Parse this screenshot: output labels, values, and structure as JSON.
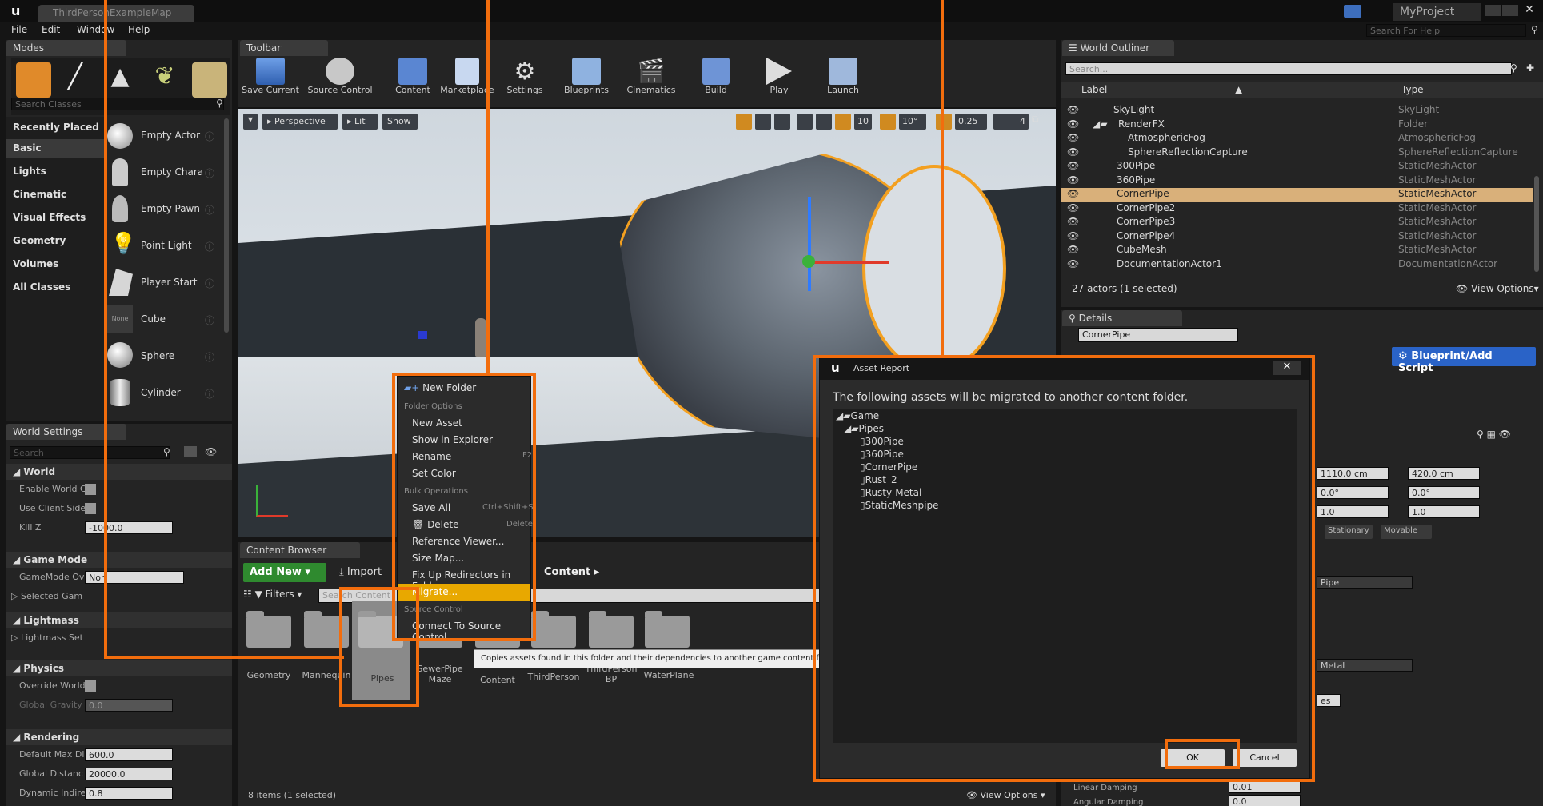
{
  "window": {
    "tab_title": "ThirdPersonExampleMap",
    "project": "MyProject",
    "help_placeholder": "Search For Help"
  },
  "menu": [
    "File",
    "Edit",
    "Window",
    "Help"
  ],
  "modes": {
    "tab": "Modes",
    "search_placeholder": "Search Classes",
    "categories": [
      "Recently Placed",
      "Basic",
      "Lights",
      "Cinematic",
      "Visual Effects",
      "Geometry",
      "Volumes",
      "All Classes"
    ],
    "items": [
      "Empty Actor",
      "Empty Chara",
      "Empty Pawn",
      "Point Light",
      "Player Start",
      "Cube",
      "Sphere",
      "Cylinder"
    ],
    "cube_tag": "None"
  },
  "world_settings": {
    "tab": "World Settings",
    "search_placeholder": "Search",
    "sections": [
      "World",
      "Game Mode",
      "Lightmass",
      "Physics",
      "Rendering"
    ],
    "world_rows": [
      "Enable World C",
      "Use Client Side",
      "Kill Z"
    ],
    "kill_z": "-1000.0",
    "gamemode_label": "GameMode Ov",
    "gamemode_value": "Non",
    "selected_gm": "Selected Gam",
    "lightmass_row": "Lightmass Set",
    "physics_rows": [
      "Override World",
      "Global Gravity"
    ],
    "gravity": "0.0",
    "rendering_rows": [
      "Default Max Di",
      "Global Distanc",
      "Dynamic Indire"
    ],
    "rendering_values": [
      "600.0",
      "20000.0",
      "0.8"
    ]
  },
  "toolbar": {
    "tab": "Toolbar",
    "buttons": [
      "Save Current",
      "Source Control",
      "Content",
      "Marketplace",
      "Settings",
      "Blueprints",
      "Cinematics",
      "Build",
      "Play",
      "Launch"
    ]
  },
  "viewport": {
    "perspective": "Perspective",
    "lit": "Lit",
    "show": "Show",
    "grid_snap": "10",
    "rot_snap": "10°",
    "scale_snap": "0.25",
    "camera_speed": "4"
  },
  "content_browser": {
    "tab": "Content Browser",
    "add_new": "Add New",
    "import": "Import",
    "path": "Content",
    "filters": "Filters",
    "search_placeholder": "Search Content",
    "folders": [
      "Geometry",
      "Mannequin",
      "Pipes",
      "SewerPipe Maze",
      "Content",
      "ThirdPerson",
      "ThirdPerson BP",
      "WaterPlane"
    ],
    "status": "8 items (1 selected)",
    "view_options": "View Options"
  },
  "context_menu": {
    "new_folder": "New Folder",
    "folder_options": "Folder Options",
    "folder_items": [
      "New Asset",
      "Show in Explorer",
      "Rename",
      "Set Color"
    ],
    "bulk_ops": "Bulk Operations",
    "save_all": "Save All",
    "save_all_shortcut": "Ctrl+Shift+S",
    "delete": "Delete",
    "delete_shortcut": "Delete",
    "bulk_items": [
      "Reference Viewer...",
      "Size Map...",
      "Fix Up Redirectors in Folder",
      "Migrate..."
    ],
    "rename_shortcut": "F2",
    "source_control": "Source Control",
    "connect": "Connect To Source Control",
    "tooltip": "Copies assets found in this folder and their dependencies to another game content folder."
  },
  "outliner": {
    "tab": "World Outliner",
    "search_placeholder": "Search...",
    "col_label": "Label",
    "col_type": "Type",
    "rows": [
      {
        "label": "SkyLight",
        "type": "SkyLight"
      },
      {
        "label": "RenderFX",
        "type": "Folder"
      },
      {
        "label": "AtmosphericFog",
        "type": "AtmosphericFog"
      },
      {
        "label": "SphereReflectionCapture",
        "type": "SphereReflectionCapture"
      },
      {
        "label": "300Pipe",
        "type": "StaticMeshActor"
      },
      {
        "label": "360Pipe",
        "type": "StaticMeshActor"
      },
      {
        "label": "CornerPipe",
        "type": "StaticMeshActor"
      },
      {
        "label": "CornerPipe2",
        "type": "StaticMeshActor"
      },
      {
        "label": "CornerPipe3",
        "type": "StaticMeshActor"
      },
      {
        "label": "CornerPipe4",
        "type": "StaticMeshActor"
      },
      {
        "label": "CubeMesh",
        "type": "StaticMeshActor"
      },
      {
        "label": "DocumentationActor1",
        "type": "DocumentationActor"
      }
    ],
    "count": "27 actors (1 selected)",
    "view_options": "View Options"
  },
  "details": {
    "tab": "Details",
    "name": "CornerPipe",
    "blueprint_btn": "Blueprint/Add Script",
    "loc_y": "1110.0 cm",
    "loc_z": "420.0 cm",
    "rot_y": "0.0°",
    "rot_z": "0.0°",
    "scale_y": "1.0",
    "scale_z": "1.0",
    "mobility": [
      "Stationary",
      "Movable"
    ],
    "mesh_value": "Pipe",
    "material_value": "Metal",
    "linear_damping": "Linear Damping",
    "angular_damping": "Angular Damping",
    "linear_value": "0.01",
    "angular_value": "0.0",
    "yes_badge": "es"
  },
  "asset_report": {
    "title": "Asset Report",
    "message": "The following assets will be migrated to another content folder.",
    "root": "Game",
    "folder": "Pipes",
    "assets": [
      "300Pipe",
      "360Pipe",
      "CornerPipe",
      "Rust_2",
      "Rusty-Metal",
      "StaticMeshpipe"
    ],
    "ok": "OK",
    "cancel": "Cancel"
  },
  "colors": {
    "highlight": "#f26d0d",
    "accent_blue": "#2a63c7",
    "menu_highlight": "#e8a800"
  }
}
